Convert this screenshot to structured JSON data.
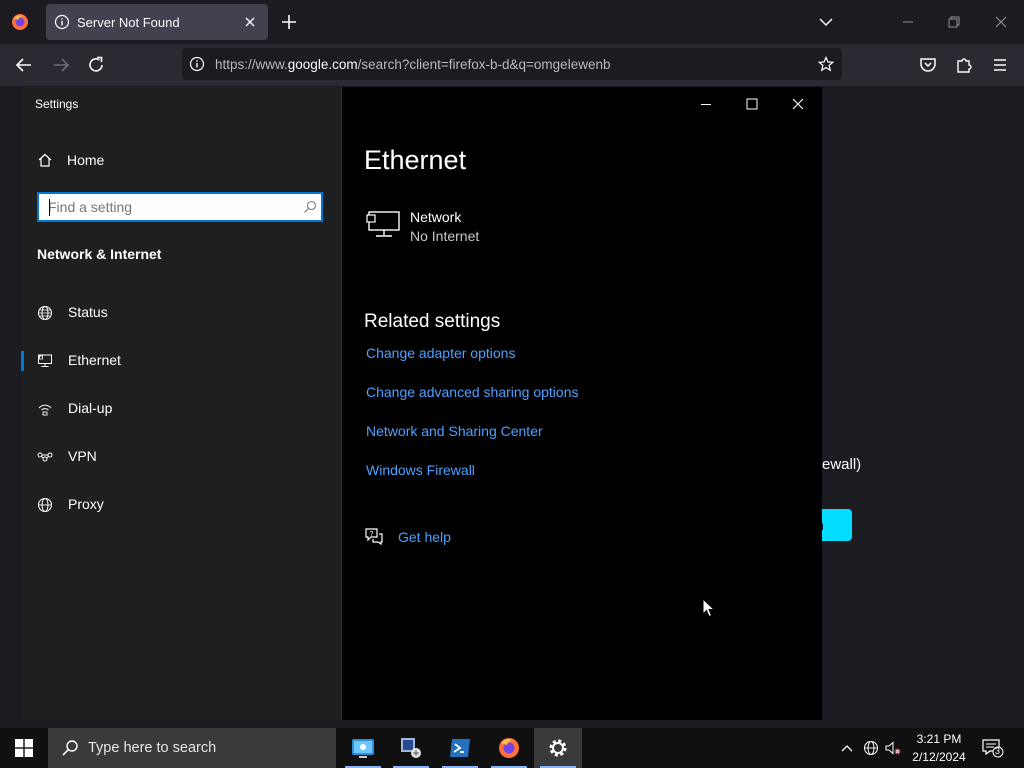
{
  "browser": {
    "tab_title": "Server Not Found",
    "url_prefix": "https://www.",
    "url_domain": "google.com",
    "url_rest": "/search?client=firefox-b-d&q=omgelewenb"
  },
  "background_page": {
    "text_fragment": "ewall)",
    "button_fragment": "n"
  },
  "settings": {
    "window_title": "Settings",
    "home_label": "Home",
    "search_placeholder": "Find a setting",
    "section_title": "Network & Internet",
    "nav": [
      {
        "label": "Status",
        "icon": "globe-status-icon"
      },
      {
        "label": "Ethernet",
        "icon": "ethernet-monitor-icon"
      },
      {
        "label": "Dial-up",
        "icon": "dialup-icon"
      },
      {
        "label": "VPN",
        "icon": "vpn-icon"
      },
      {
        "label": "Proxy",
        "icon": "globe-icon"
      }
    ],
    "selected_nav": "Ethernet",
    "page_title": "Ethernet",
    "network_name": "Network",
    "network_status": "No Internet",
    "related_title": "Related settings",
    "related_links": [
      "Change adapter options",
      "Change advanced sharing options",
      "Network and Sharing Center",
      "Windows Firewall"
    ],
    "help_label": "Get help"
  },
  "taskbar": {
    "search_placeholder": "Type here to search",
    "apps": [
      "remote-desktop-icon",
      "network-admin-icon",
      "powershell-icon",
      "firefox-icon",
      "settings-gear-icon"
    ],
    "time": "3:21 PM",
    "date": "2/12/2024",
    "notification_count": "3"
  },
  "colors": {
    "accent": "#0078d7",
    "link": "#4ca0ff",
    "firefox_cyan": "#00ddff"
  }
}
